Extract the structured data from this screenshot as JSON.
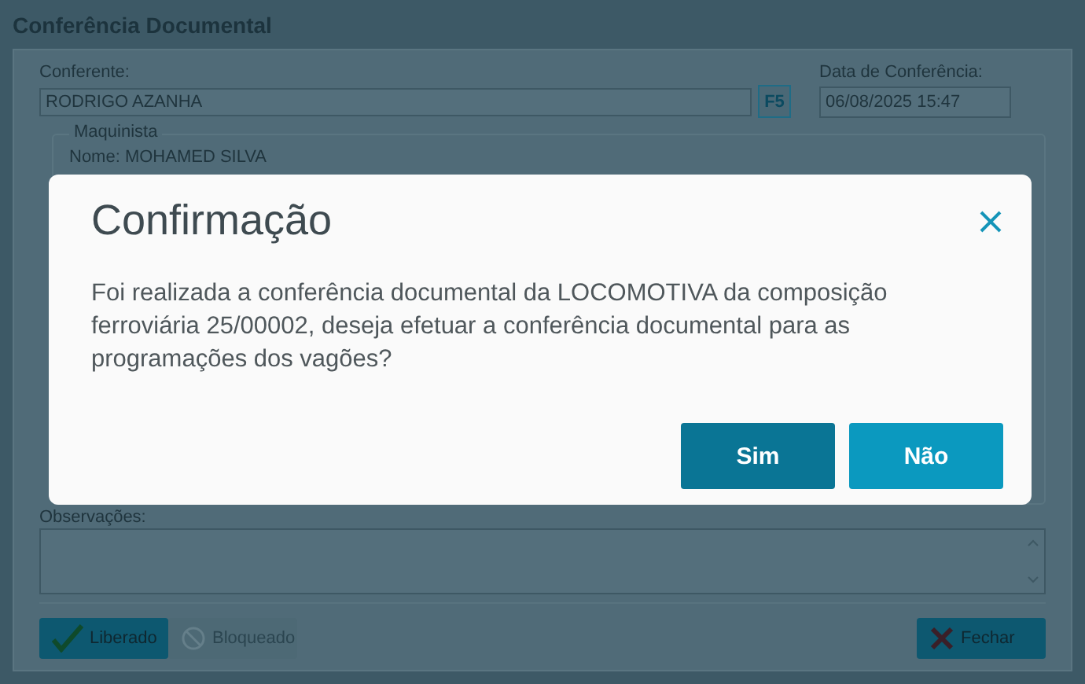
{
  "window": {
    "title": "Conferência Documental"
  },
  "form": {
    "conferente_label": "Conferente:",
    "conferente_value": "RODRIGO AZANHA",
    "lookup_key": "F5",
    "date_label": "Data de Conferência:",
    "date_value": "06/08/2025 15:47",
    "group_title": "Maquinista",
    "group_line": "Nome: MOHAMED SILVA",
    "notes_label": "Observações:"
  },
  "buttons": [
    {
      "label": "Liberado",
      "kind": "check",
      "disabled": false
    },
    {
      "label": "Bloqueado",
      "kind": "block",
      "disabled": true
    },
    {
      "label": "Fechar",
      "kind": "close",
      "disabled": false
    }
  ],
  "dialog": {
    "title": "Confirmação",
    "message": "Foi realizada a conferência documental da LOCOMOTIVA da composição ferroviária 25/00002, deseja efetuar a conferência documental para as programações dos vagões?",
    "buttons": [
      {
        "label": "Sim",
        "kind": "primary"
      },
      {
        "label": "Não",
        "kind": "secondary"
      }
    ]
  }
}
